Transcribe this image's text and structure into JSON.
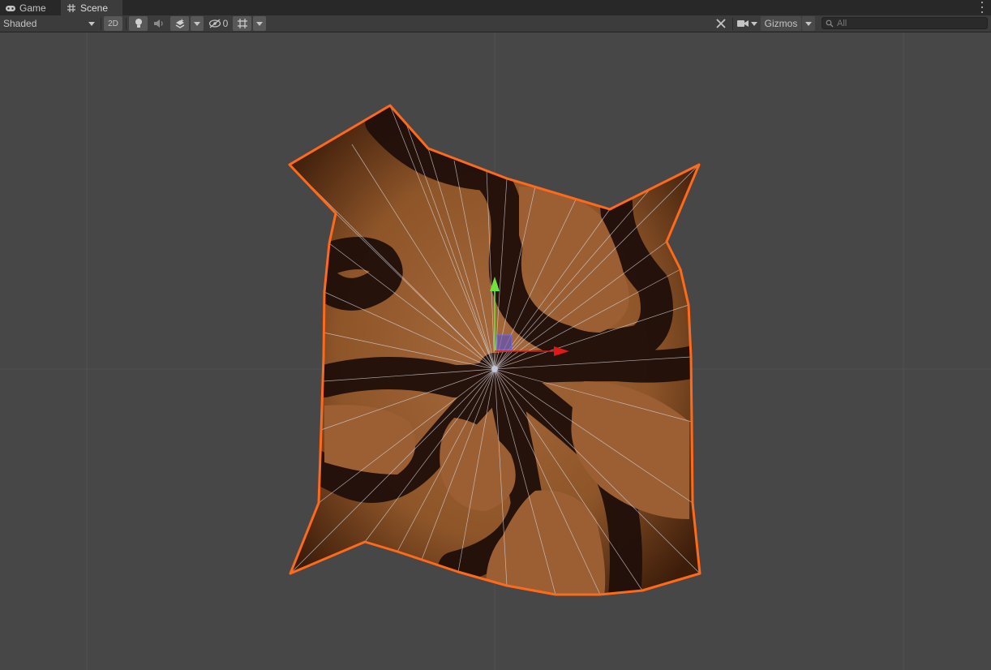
{
  "tabs": [
    {
      "label": "Game",
      "icon": "gamepad-icon"
    },
    {
      "label": "Scene",
      "icon": "grid-hash-icon",
      "active": true
    }
  ],
  "toolbar": {
    "draw_mode": "Shaded",
    "mode_2d_label": "2D",
    "hidden_count": "0",
    "gizmos_label": "Gizmos",
    "search_placeholder": "All"
  },
  "colors": {
    "panel_bg": "#3c3c3c",
    "tabbar_bg": "#282828",
    "viewport_bg": "#474747",
    "selection_outline": "#ff6a1a",
    "light_terrain": "#9c6236",
    "dark_terrain": "#241108",
    "gizmo_y": "#70e23a",
    "gizmo_x": "#e01818",
    "gizmo_center": "#4c4cd8"
  }
}
